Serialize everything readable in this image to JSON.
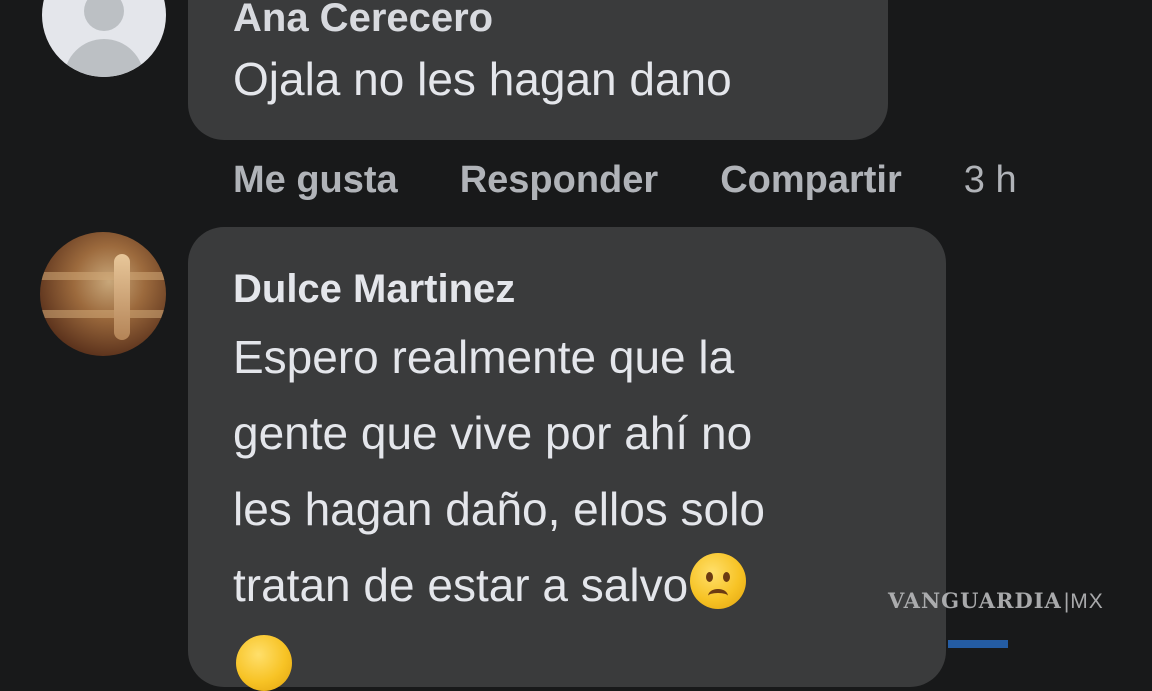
{
  "comments": [
    {
      "author": "Ana Cerecero",
      "text": "Ojala no les hagan dano"
    },
    {
      "author": "Dulce Martinez",
      "text": "Espero realmente que la\ngente que vive por ahí no\nles hagan daño, ellos solo\ntratan de estar a salvo",
      "emoji": "frowning-face-icon"
    }
  ],
  "actions": {
    "like": "Me gusta",
    "reply": "Responder",
    "share": "Compartir",
    "time": "3 h"
  },
  "watermark": {
    "brand": "VANGUARDIA",
    "suffix": "|MX"
  },
  "colors": {
    "background": "#18191a",
    "bubble": "#3a3b3c",
    "text": "#e4e6eb",
    "secondary_text": "#b0b3b8"
  }
}
